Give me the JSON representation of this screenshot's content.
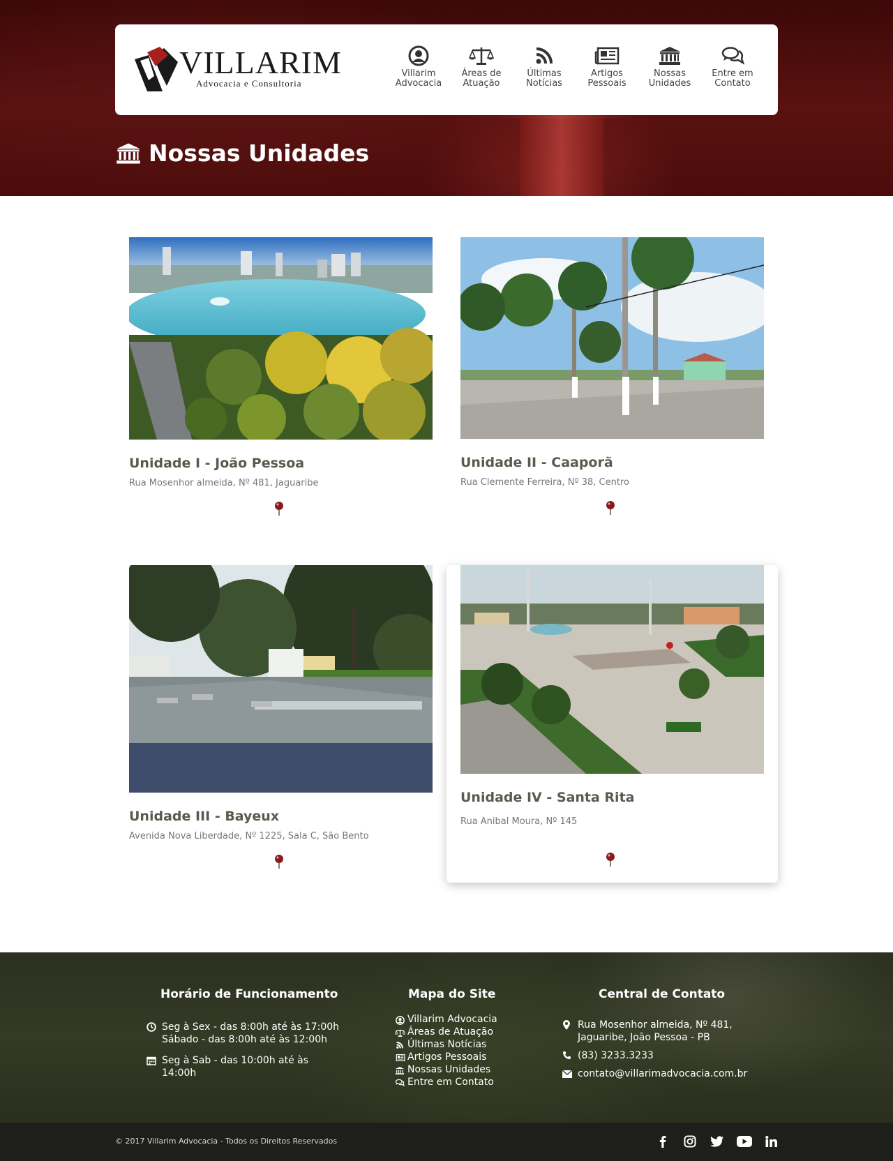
{
  "brand": {
    "name": "VILLARIM",
    "tagline": "Advocacia e Consultoria",
    "accent_color": "#8b1a1a",
    "heading_color": "#5a5a4e"
  },
  "nav": {
    "items": [
      {
        "label": "Villarim\nAdvocacia",
        "icon": "user-circle-icon"
      },
      {
        "label": "Áreas de\nAtuação",
        "icon": "balance-scale-icon"
      },
      {
        "label": "Últimas\nNotícias",
        "icon": "rss-icon"
      },
      {
        "label": "Artigos\nPessoais",
        "icon": "newspaper-icon"
      },
      {
        "label": "Nossas\nUnidades",
        "icon": "institution-icon"
      },
      {
        "label": "Entre em\nContato",
        "icon": "comments-icon"
      }
    ]
  },
  "page": {
    "title": "Nossas Unidades",
    "title_icon": "institution-icon"
  },
  "units": [
    {
      "name": "Unidade I - João Pessoa",
      "address": "Rua Mosenhor almeida, Nº 481, Jaguaribe",
      "photo": "lake-park-city-photo"
    },
    {
      "name": "Unidade II - Caaporã",
      "address": "Rua Clemente Ferreira, Nº 38, Centro",
      "photo": "palm-tree-plaza-photo"
    },
    {
      "name": "Unidade III - Bayeux",
      "address": "Avenida Nova Liberdade, Nº 1225, Sala C, São Bento",
      "photo": "tree-square-photo"
    },
    {
      "name": "Unidade IV - Santa Rita",
      "address": "Rua Anibal Moura, Nº 145",
      "photo": "paved-plaza-photo"
    }
  ],
  "footer": {
    "hours": {
      "title": "Horário de Funcionamento",
      "entries": [
        {
          "icon": "clock-icon",
          "text": "Seg à Sex - das 8:00h até às 17:00h\nSábado - das 8:00h até às 12:00h"
        },
        {
          "icon": "calendar-icon",
          "text": "Seg à Sab - das 10:00h até às\n14:00h"
        }
      ]
    },
    "sitemap": {
      "title": "Mapa do Site",
      "items": [
        {
          "label": "Villarim Advocacia",
          "icon": "user-circle-icon"
        },
        {
          "label": "Áreas de Atuação",
          "icon": "balance-scale-icon"
        },
        {
          "label": "Últimas Notícias",
          "icon": "rss-icon"
        },
        {
          "label": "Artigos Pessoais",
          "icon": "newspaper-icon"
        },
        {
          "label": "Nossas Unidades",
          "icon": "institution-icon"
        },
        {
          "label": "Entre em Contato",
          "icon": "comments-icon"
        }
      ]
    },
    "contact": {
      "title": "Central de Contato",
      "address": "Rua Mosenhor almeida, Nº 481,\nJaguaribe, João Pessoa - PB",
      "phone": "(83) 3233.3233",
      "email": "contato@villarimadvocacia.com.br"
    },
    "copyright": "© 2017 Villarim Advocacia - Todos os Direitos Reservados",
    "socials": [
      "facebook-icon",
      "instagram-icon",
      "twitter-icon",
      "youtube-icon",
      "linkedin-icon"
    ]
  }
}
